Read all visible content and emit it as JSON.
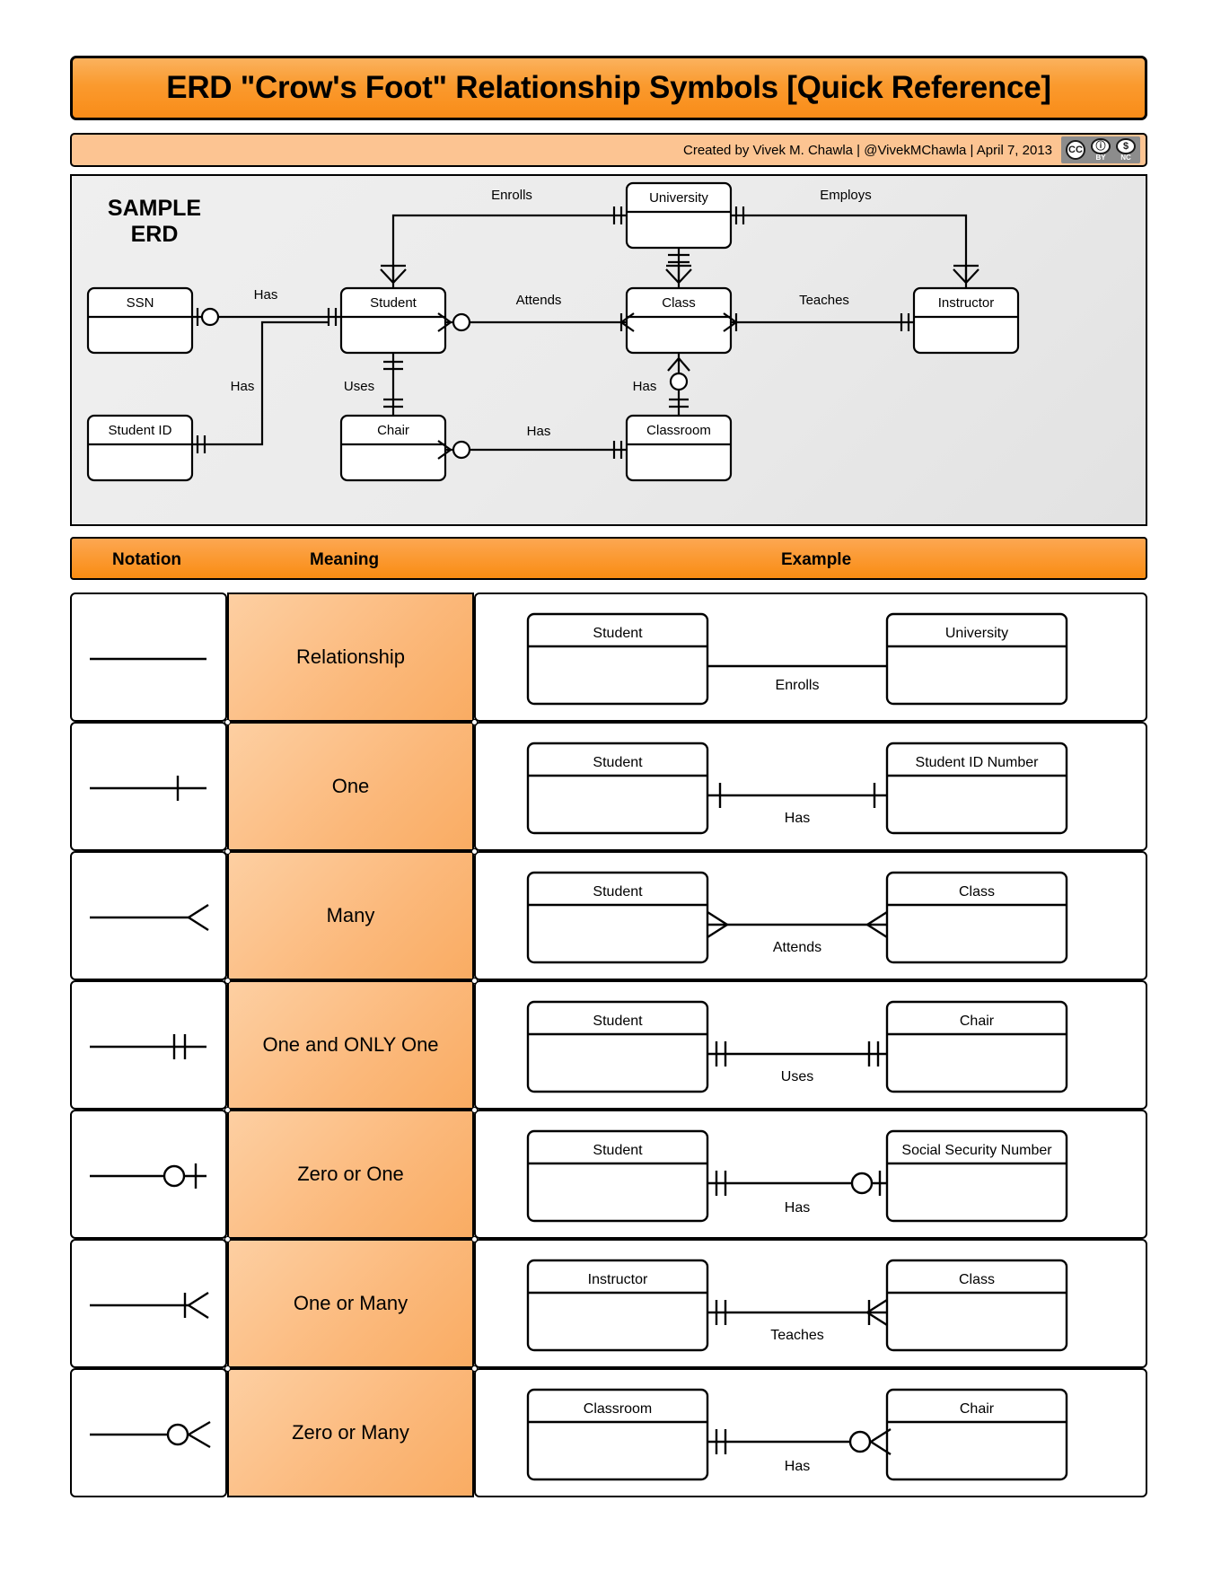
{
  "title": "ERD \"Crow's Foot\" Relationship Symbols [Quick Reference]",
  "credits": {
    "text": "Created by Vivek M. Chawla |  @VivekMChawla  |  April 7, 2013",
    "cc_badges": [
      {
        "mark": "CC",
        "sub": ""
      },
      {
        "mark": "ⓘ",
        "sub": "BY"
      },
      {
        "mark": "$",
        "sub": "NC"
      }
    ]
  },
  "sample_erd": {
    "label_line1": "SAMPLE",
    "label_line2": "ERD",
    "entities": [
      {
        "id": "ssn",
        "name": "SSN"
      },
      {
        "id": "student_id",
        "name": "Student ID"
      },
      {
        "id": "student",
        "name": "Student"
      },
      {
        "id": "chair",
        "name": "Chair"
      },
      {
        "id": "university",
        "name": "University"
      },
      {
        "id": "class",
        "name": "Class"
      },
      {
        "id": "classroom",
        "name": "Classroom"
      },
      {
        "id": "instructor",
        "name": "Instructor"
      }
    ],
    "relationships": [
      {
        "label": "Has",
        "from": "ssn",
        "to": "student"
      },
      {
        "label": "Has",
        "from": "student_id",
        "to": "student"
      },
      {
        "label": "Enrolls",
        "from": "student",
        "to": "university"
      },
      {
        "label": "Attends",
        "from": "student",
        "to": "class"
      },
      {
        "label": "Employs",
        "from": "university",
        "to": "instructor"
      },
      {
        "label": "Teaches",
        "from": "class",
        "to": "instructor"
      },
      {
        "label": "Uses",
        "from": "student",
        "to": "chair"
      },
      {
        "label": "Has",
        "from": "class",
        "to": "classroom"
      },
      {
        "label": "Has",
        "from": "chair",
        "to": "classroom"
      }
    ]
  },
  "table": {
    "headers": {
      "notation": "Notation",
      "meaning": "Meaning",
      "example": "Example"
    },
    "rows": [
      {
        "notation": "relationship",
        "meaning": "Relationship",
        "example": {
          "left": "Student",
          "right": "University",
          "label": "Enrolls"
        }
      },
      {
        "notation": "one",
        "meaning": "One",
        "example": {
          "left": "Student",
          "right": "Student ID Number",
          "label": "Has"
        }
      },
      {
        "notation": "many",
        "meaning": "Many",
        "example": {
          "left": "Student",
          "right": "Class",
          "label": "Attends"
        }
      },
      {
        "notation": "one-and-only-one",
        "meaning": "One and ONLY One",
        "example": {
          "left": "Student",
          "right": "Chair",
          "label": "Uses"
        }
      },
      {
        "notation": "zero-or-one",
        "meaning": "Zero or One",
        "example": {
          "left": "Student",
          "right": "Social Security Number",
          "label": "Has"
        }
      },
      {
        "notation": "one-or-many",
        "meaning": "One or Many",
        "example": {
          "left": "Instructor",
          "right": "Class",
          "label": "Teaches"
        }
      },
      {
        "notation": "zero-or-many",
        "meaning": "Zero or Many",
        "example": {
          "left": "Classroom",
          "right": "Chair",
          "label": "Has"
        }
      }
    ]
  },
  "colors": {
    "title_orange": "#f98c18",
    "credits_peach": "#fcc492",
    "meaning_orange": "#fbb87a",
    "panel_grey": "#ebebeb"
  }
}
